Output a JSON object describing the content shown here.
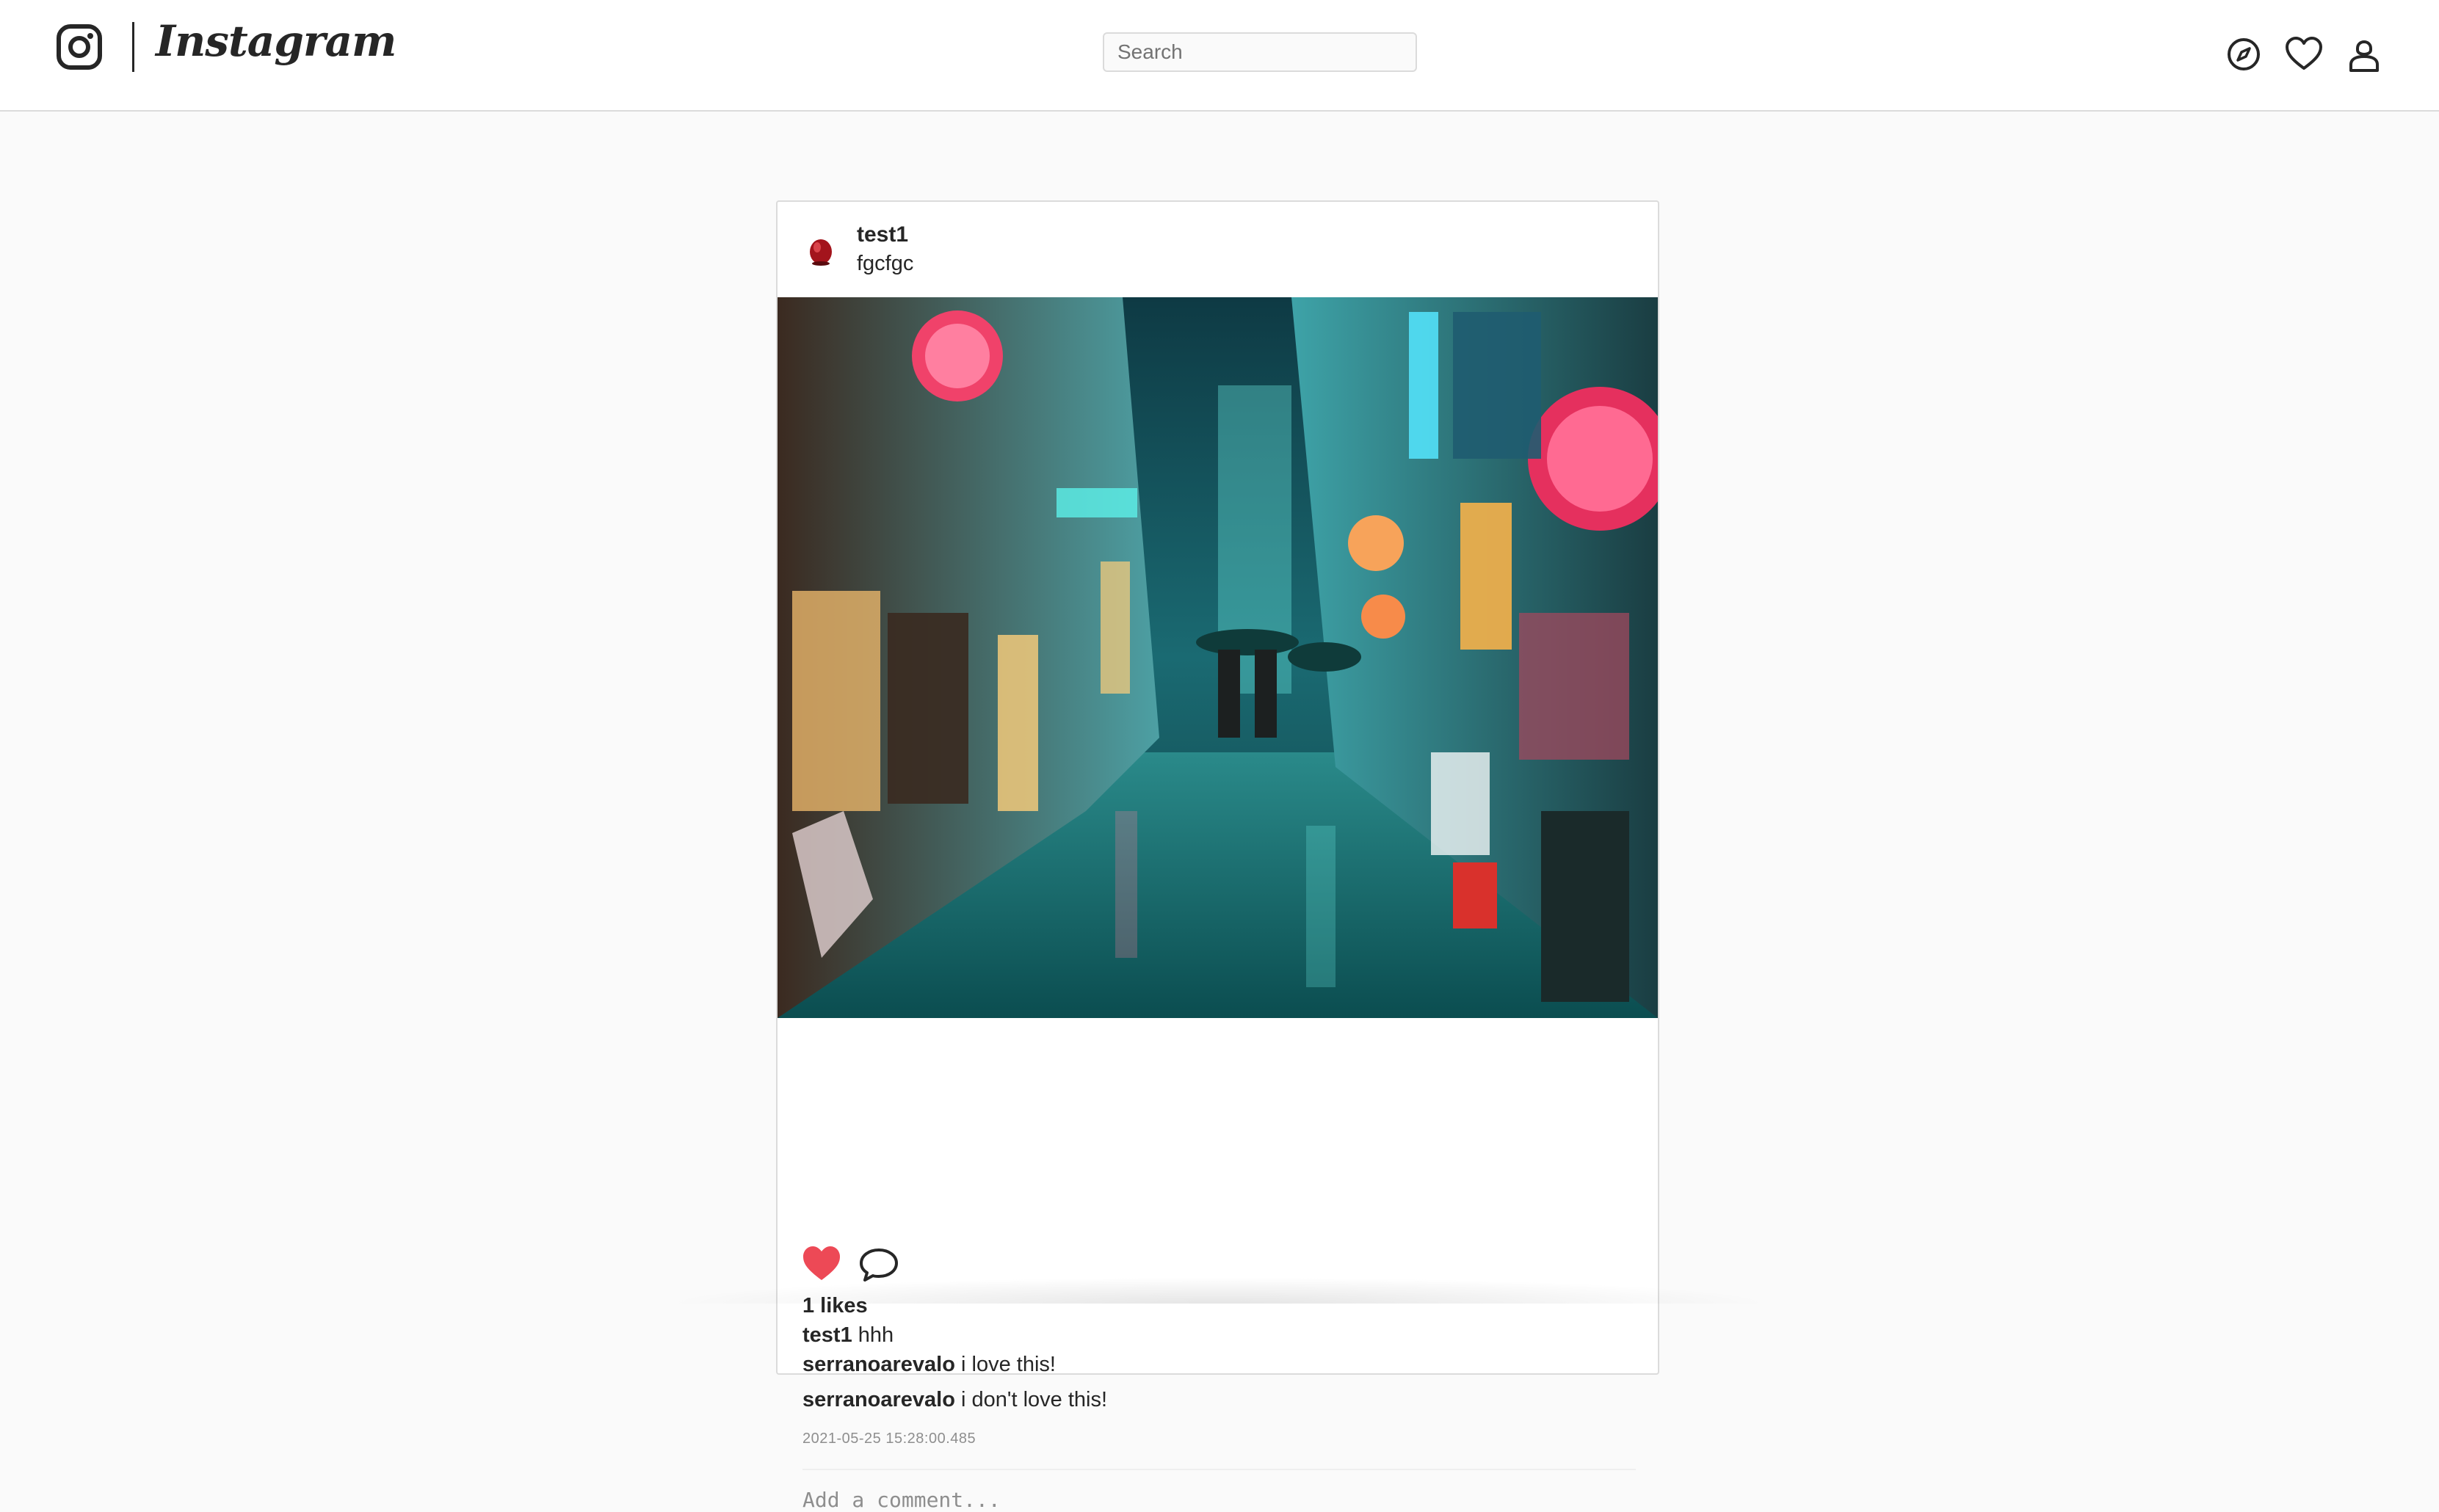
{
  "header": {
    "brand": "Instagram",
    "search_placeholder": "Search",
    "icons": [
      "instagram-camera-icon",
      "compass-icon",
      "heart-icon",
      "profile-icon"
    ]
  },
  "post": {
    "username": "test1",
    "location": "fgcfgc",
    "photo_icon": "neon-street-photo",
    "liked": true,
    "like_color": "#ed4956",
    "likes_text": "1 likes",
    "caption": {
      "user": "test1",
      "text": "hhh"
    },
    "comments": [
      {
        "user": "serranoarevalo",
        "text": "i love this!"
      },
      {
        "user": "serranoarevalo",
        "text": "i don't love this!"
      }
    ],
    "timestamp": "2021-05-25 15:28:00.485",
    "add_comment_placeholder": "Add a comment..."
  },
  "colors": {
    "background": "#fafafa",
    "border": "#dbdbdb",
    "text": "#262626",
    "muted": "#8e8e8e",
    "like": "#ed4956"
  }
}
